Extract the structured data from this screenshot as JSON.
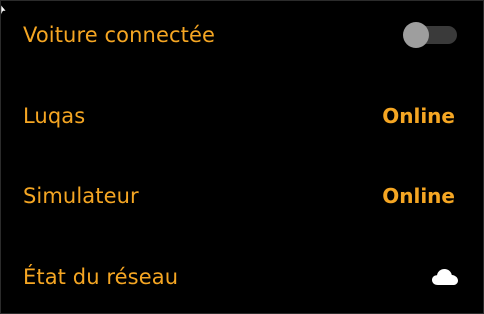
{
  "settings": {
    "rows": [
      {
        "label": "Voiture connectée",
        "toggle_on": false
      },
      {
        "label": "Luqas",
        "status": "Online"
      },
      {
        "label": "Simulateur",
        "status": "Online"
      },
      {
        "label": "État du réseau",
        "icon": "cloud-icon"
      }
    ]
  },
  "colors": {
    "accent": "#f5a623",
    "background": "#000000",
    "toggle_track": "#3a3a3a",
    "toggle_knob": "#9e9e9e",
    "icon": "#ffffff"
  }
}
